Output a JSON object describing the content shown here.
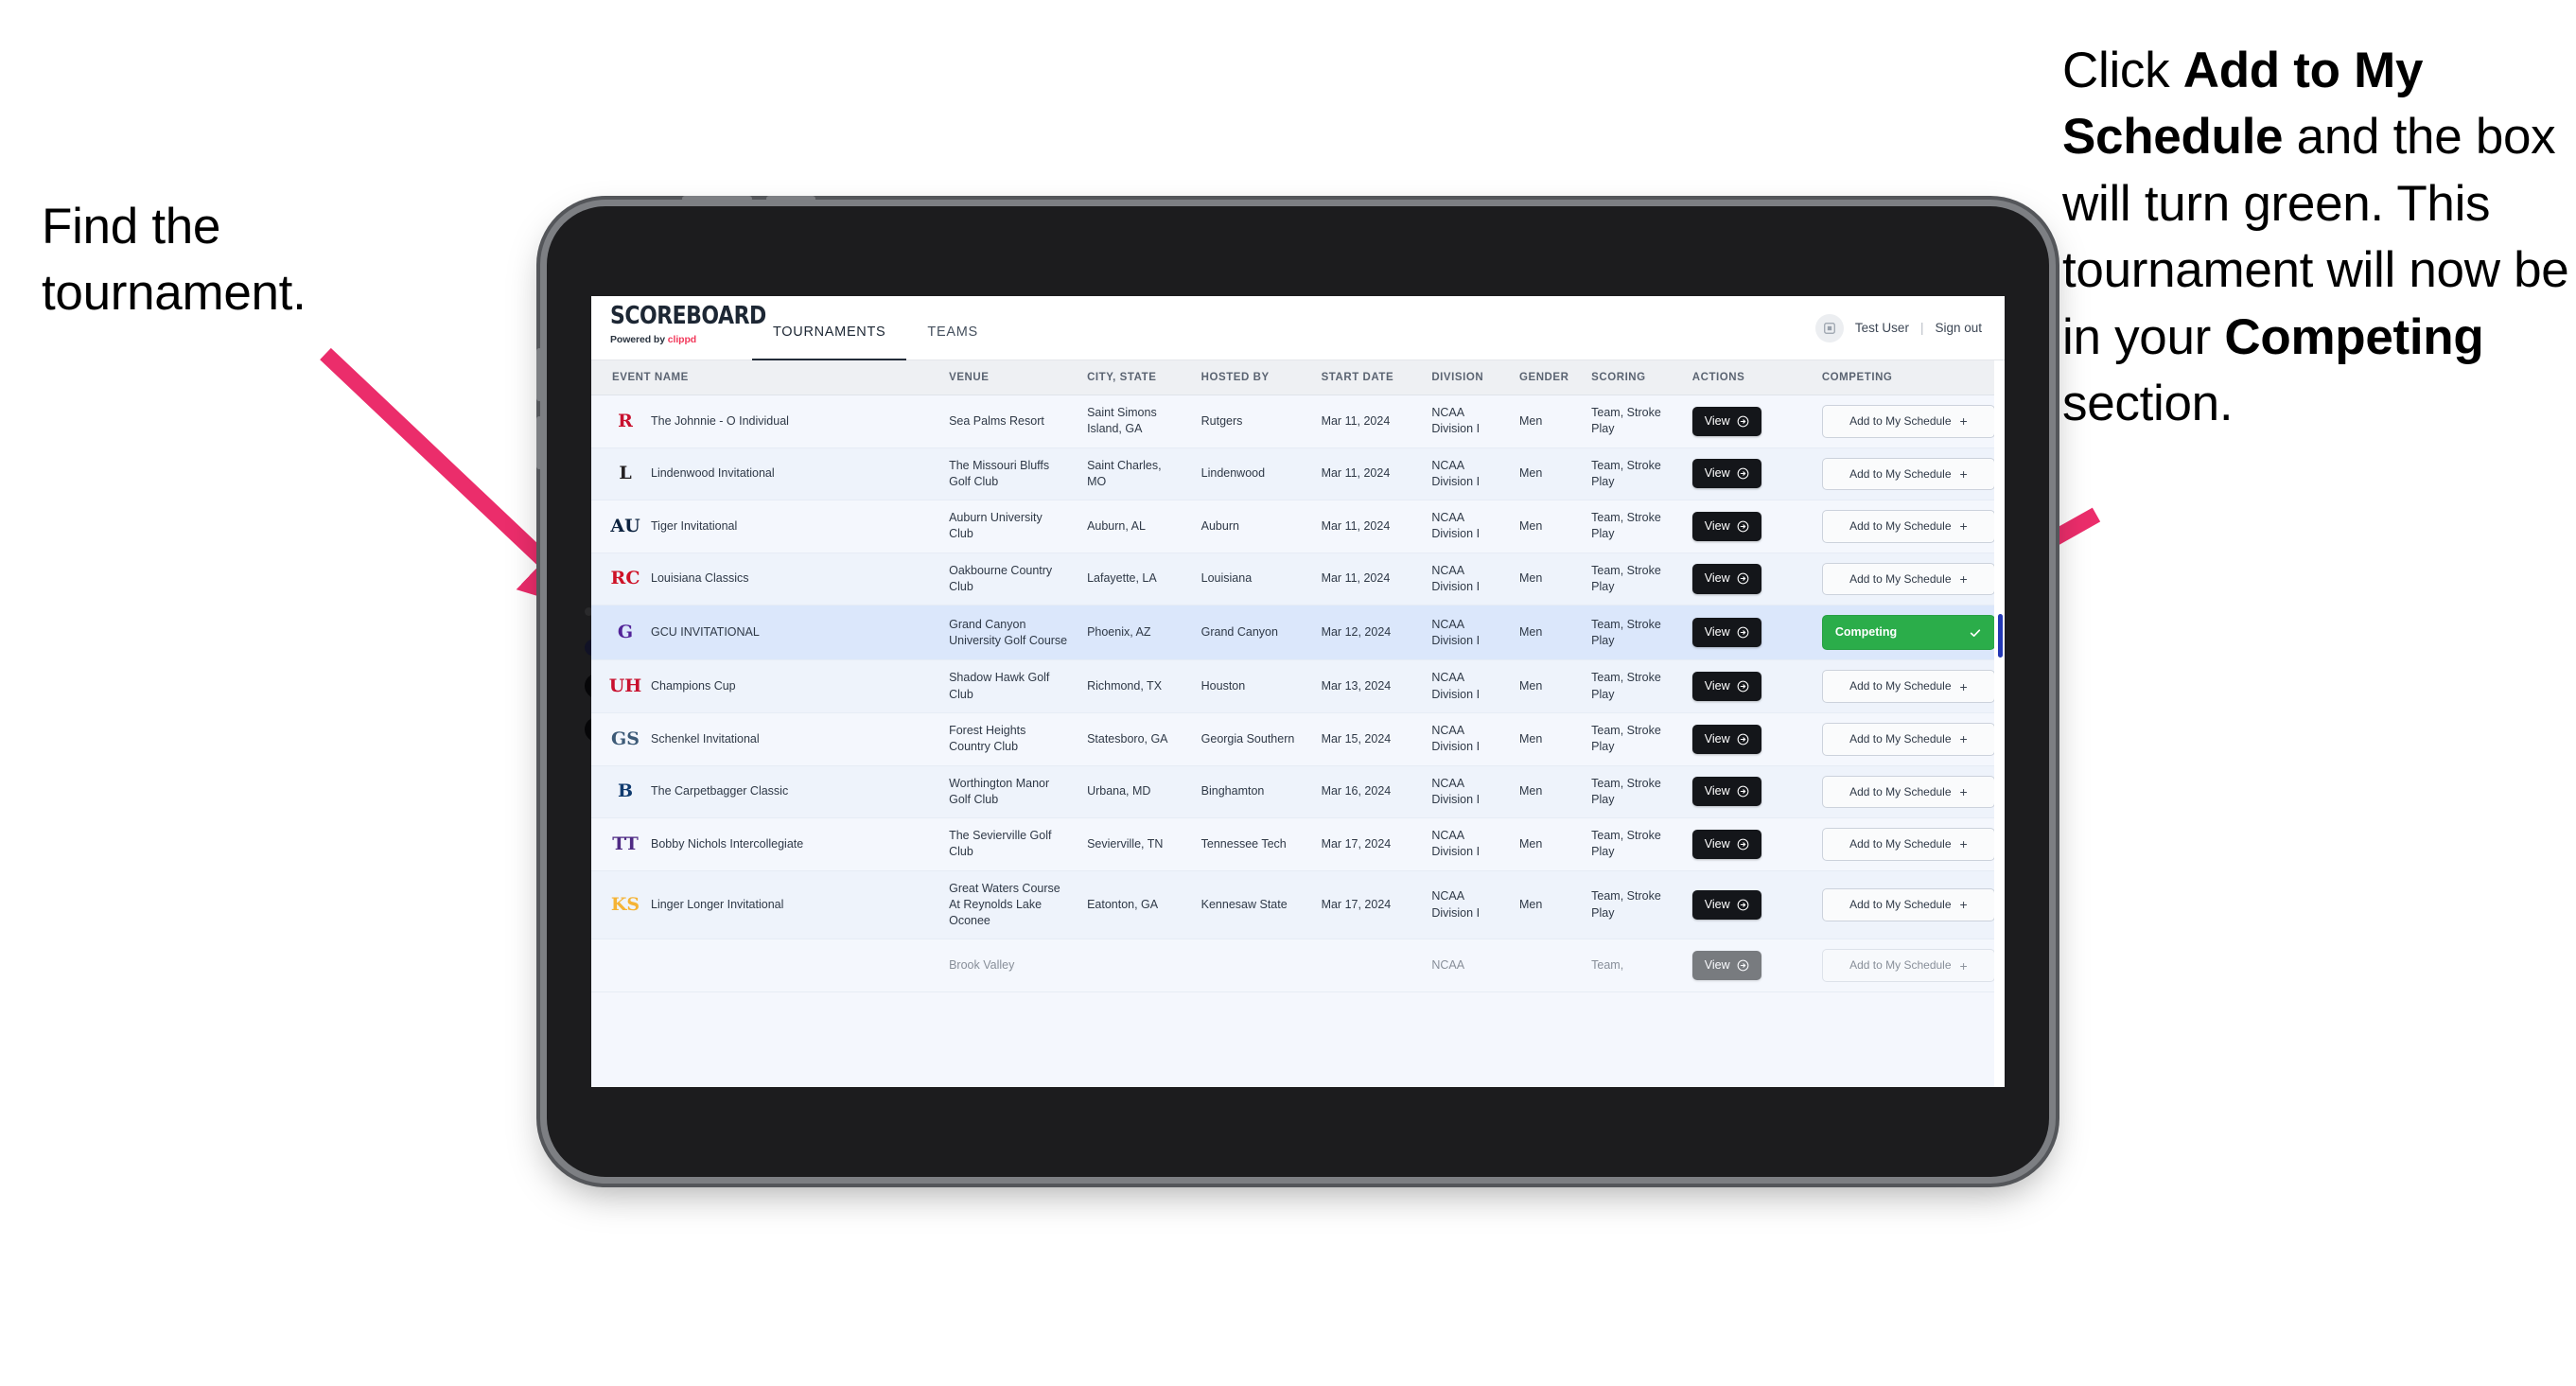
{
  "annotations": {
    "left": "Find the tournament.",
    "right_parts": [
      {
        "t": "Click ",
        "b": false
      },
      {
        "t": "Add to My Schedule",
        "b": true
      },
      {
        "t": " and the box will turn green. This tournament will now be in your ",
        "b": false
      },
      {
        "t": "Competing",
        "b": true
      },
      {
        "t": " section.",
        "b": false
      }
    ],
    "arrow_color": "#eb2d6b"
  },
  "app": {
    "brand": {
      "title": "SCOREBOARD",
      "powered_prefix": "Powered by ",
      "powered_brand": "clippd"
    },
    "tabs": [
      {
        "label": "TOURNAMENTS",
        "active": true
      },
      {
        "label": "TEAMS",
        "active": false
      }
    ],
    "header_right": {
      "user": "Test User",
      "separator": "|",
      "sign_out": "Sign out"
    },
    "table": {
      "columns": [
        "EVENT NAME",
        "VENUE",
        "CITY, STATE",
        "HOSTED BY",
        "START DATE",
        "DIVISION",
        "GENDER",
        "SCORING",
        "ACTIONS",
        "COMPETING"
      ],
      "view_label": "View",
      "add_label": "Add to My Schedule",
      "add_plus": "+",
      "competing_label": "Competing",
      "rows": [
        {
          "event": "The Johnnie - O Individual",
          "logo_text": "R",
          "logo_color": "#c8102e",
          "venue": "Sea Palms Resort",
          "city": "Saint Simons Island, GA",
          "host": "Rutgers",
          "date": "Mar 11, 2024",
          "division": "NCAA Division I",
          "gender": "Men",
          "scoring": "Team, Stroke Play",
          "competing": false
        },
        {
          "event": "Lindenwood Invitational",
          "logo_text": "L",
          "logo_color": "#231f20",
          "venue": "The Missouri Bluffs Golf Club",
          "city": "Saint Charles, MO",
          "host": "Lindenwood",
          "date": "Mar 11, 2024",
          "division": "NCAA Division I",
          "gender": "Men",
          "scoring": "Team, Stroke Play",
          "competing": false
        },
        {
          "event": "Tiger Invitational",
          "logo_text": "AU",
          "logo_color": "#0c2340",
          "venue": "Auburn University Club",
          "city": "Auburn, AL",
          "host": "Auburn",
          "date": "Mar 11, 2024",
          "division": "NCAA Division I",
          "gender": "Men",
          "scoring": "Team, Stroke Play",
          "competing": false
        },
        {
          "event": "Louisiana Classics",
          "logo_text": "RC",
          "logo_color": "#ce1126",
          "venue": "Oakbourne Country Club",
          "city": "Lafayette, LA",
          "host": "Louisiana",
          "date": "Mar 11, 2024",
          "division": "NCAA Division I",
          "gender": "Men",
          "scoring": "Team, Stroke Play",
          "competing": false
        },
        {
          "event": "GCU INVITATIONAL",
          "logo_text": "G",
          "logo_color": "#522398",
          "venue": "Grand Canyon University Golf Course",
          "city": "Phoenix, AZ",
          "host": "Grand Canyon",
          "date": "Mar 12, 2024",
          "division": "NCAA Division I",
          "gender": "Men",
          "scoring": "Team, Stroke Play",
          "competing": true
        },
        {
          "event": "Champions Cup",
          "logo_text": "UH",
          "logo_color": "#c8102e",
          "venue": "Shadow Hawk Golf Club",
          "city": "Richmond, TX",
          "host": "Houston",
          "date": "Mar 13, 2024",
          "division": "NCAA Division I",
          "gender": "Men",
          "scoring": "Team, Stroke Play",
          "competing": false
        },
        {
          "event": "Schenkel Invitational",
          "logo_text": "GS",
          "logo_color": "#3c5a77",
          "venue": "Forest Heights Country Club",
          "city": "Statesboro, GA",
          "host": "Georgia Southern",
          "date": "Mar 15, 2024",
          "division": "NCAA Division I",
          "gender": "Men",
          "scoring": "Team, Stroke Play",
          "competing": false
        },
        {
          "event": "The Carpetbagger Classic",
          "logo_text": "B",
          "logo_color": "#0f3a6e",
          "venue": "Worthington Manor Golf Club",
          "city": "Urbana, MD",
          "host": "Binghamton",
          "date": "Mar 16, 2024",
          "division": "NCAA Division I",
          "gender": "Men",
          "scoring": "Team, Stroke Play",
          "competing": false
        },
        {
          "event": "Bobby Nichols Intercollegiate",
          "logo_text": "TT",
          "logo_color": "#4e2a84",
          "venue": "The Sevierville Golf Club",
          "city": "Sevierville, TN",
          "host": "Tennessee Tech",
          "date": "Mar 17, 2024",
          "division": "NCAA Division I",
          "gender": "Men",
          "scoring": "Team, Stroke Play",
          "competing": false
        },
        {
          "event": "Linger Longer Invitational",
          "logo_text": "KS",
          "logo_color": "#f5b335",
          "venue": "Great Waters Course At Reynolds Lake Oconee",
          "city": "Eatonton, GA",
          "host": "Kennesaw State",
          "date": "Mar 17, 2024",
          "division": "NCAA Division I",
          "gender": "Men",
          "scoring": "Team, Stroke Play",
          "competing": false
        },
        {
          "event": "",
          "logo_text": "",
          "logo_color": "#3b2a6b",
          "venue": "Brook Valley",
          "city": "",
          "host": "",
          "date": "",
          "division": "NCAA",
          "gender": "",
          "scoring": "Team,",
          "competing": false
        }
      ]
    }
  }
}
